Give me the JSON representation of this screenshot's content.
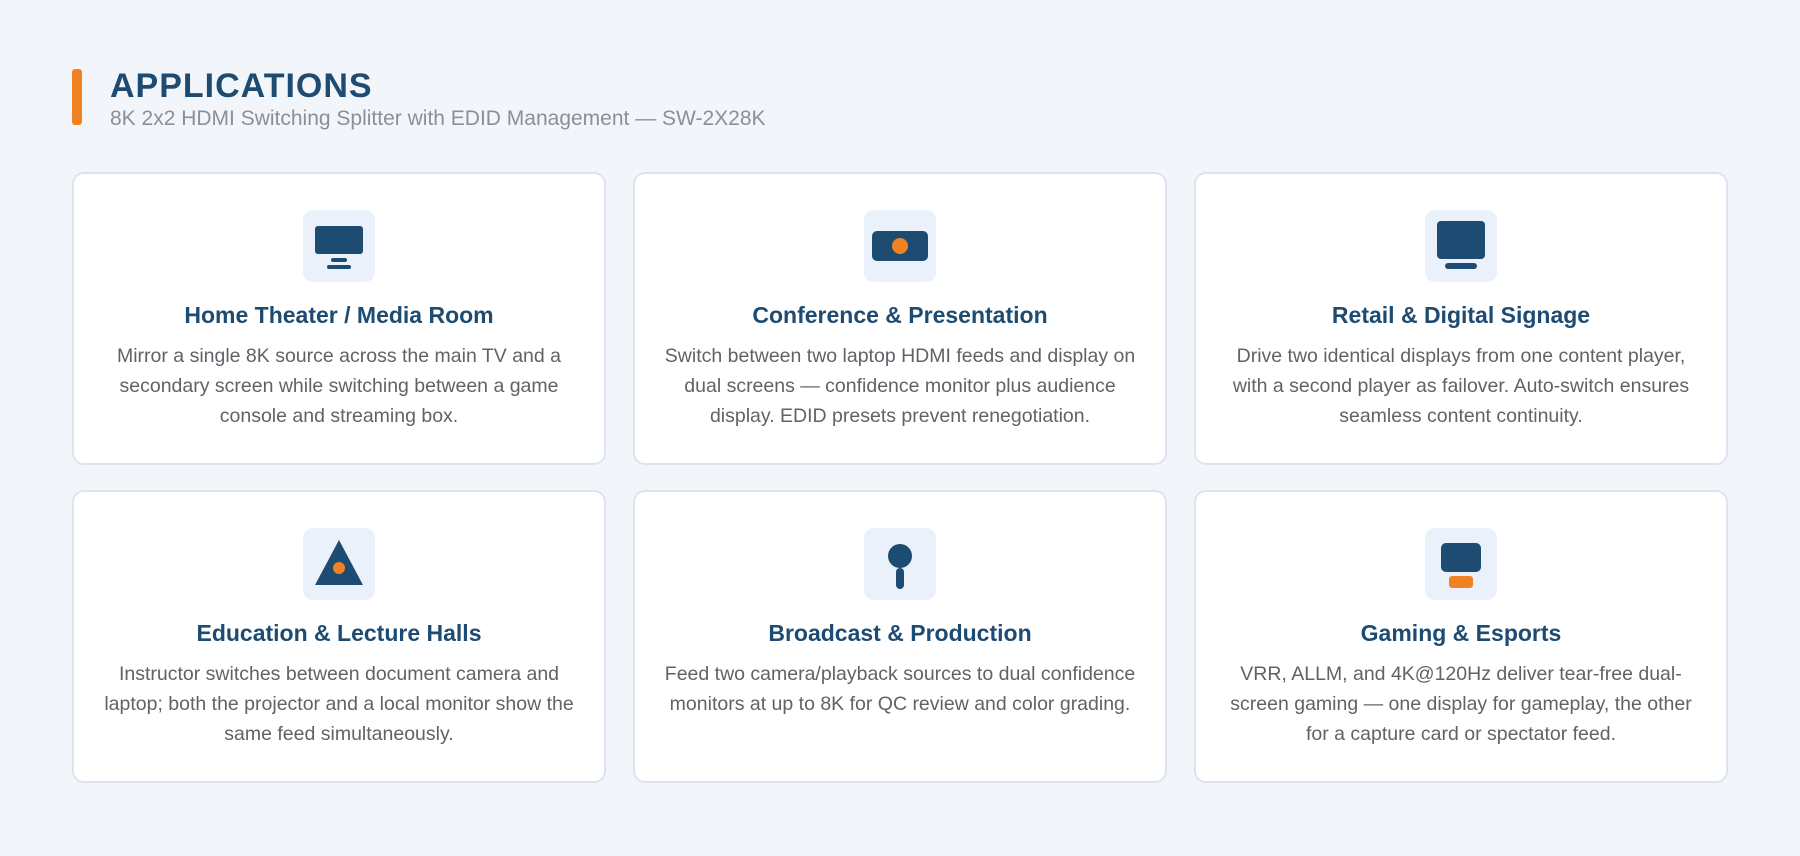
{
  "header": {
    "title": "APPLICATIONS",
    "subtitle": "8K 2x2 HDMI Switching Splitter with EDID Management — SW-2X28K"
  },
  "colors": {
    "accent": "#f08223",
    "primary": "#1d4b72",
    "icon_bg": "#eaf1fb",
    "page_bg": "#f2f6fa"
  },
  "cards": [
    {
      "icon": "monitor-icon",
      "title": "Home Theater / Media Room",
      "description": "Mirror a single 8K source across the main TV and a secondary screen while switching between a game console and streaming box."
    },
    {
      "icon": "projector-icon",
      "title": "Conference & Presentation",
      "description": "Switch between two laptop HDMI feeds and display on dual screens — confidence monitor plus audience display. EDID presets prevent renegotiation."
    },
    {
      "icon": "display-icon",
      "title": "Retail & Digital Signage",
      "description": "Drive two identical displays from one content player, with a second player as failover. Auto-switch ensures seamless content continuity."
    },
    {
      "icon": "triangle-icon",
      "title": "Education & Lecture Halls",
      "description": "Instructor switches between document camera and laptop; both the projector and a local monitor show the same feed simultaneously."
    },
    {
      "icon": "microphone-icon",
      "title": "Broadcast & Production",
      "description": "Feed two camera/playback sources to dual confidence monitors at up to 8K for QC review and color grading."
    },
    {
      "icon": "gaming-icon",
      "title": "Gaming & Esports",
      "description": "VRR, ALLM, and 4K@120Hz deliver tear-free dual-screen gaming — one display for gameplay, the other for a capture card or spectator feed."
    }
  ]
}
